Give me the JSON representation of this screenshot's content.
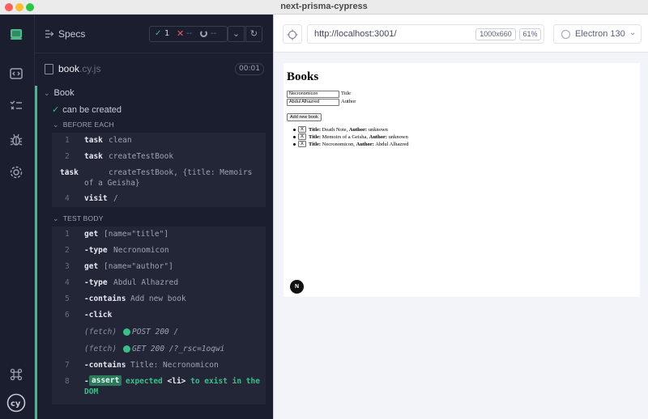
{
  "window": {
    "title": "next-prisma-cypress"
  },
  "reporter": {
    "specs_label": "Specs",
    "stats": {
      "passed": "1",
      "failed": "--",
      "pending": "--"
    },
    "file": {
      "name": "book",
      "ext": ".cy.js",
      "duration": "00:01"
    },
    "suite": {
      "title": "Book"
    },
    "test": {
      "title": "can be created"
    },
    "before_each": {
      "title": "BEFORE EACH",
      "commands": [
        {
          "num": "1",
          "name": "task",
          "message": "clean"
        },
        {
          "num": "2",
          "name": "task",
          "message": "createTestBook"
        },
        {
          "num": "3",
          "name": "task",
          "message": "createTestBook, {title: Memoirs of a Geisha}"
        },
        {
          "num": "4",
          "name": "visit",
          "message": "/"
        }
      ]
    },
    "test_body": {
      "title": "TEST BODY",
      "commands": [
        {
          "num": "1",
          "name": "get",
          "message": "[name=\"title\"]"
        },
        {
          "num": "2",
          "name": "-type",
          "message": "Necronomicon"
        },
        {
          "num": "3",
          "name": "get",
          "message": "[name=\"author\"]"
        },
        {
          "num": "4",
          "name": "-type",
          "message": "Abdul Alhazred"
        },
        {
          "num": "5",
          "name": "-contains",
          "message": "Add new book"
        },
        {
          "num": "6",
          "name": "-click",
          "message": ""
        },
        {
          "num": "",
          "name": "(fetch)",
          "message": "POST 200 /"
        },
        {
          "num": "",
          "name": "(fetch)",
          "message": "GET 200 /?_rsc=1oqwi"
        },
        {
          "num": "7",
          "name": "-contains",
          "message": "Title: Necronomicon"
        },
        {
          "num": "8",
          "name": "-",
          "badge": "assert",
          "expected": "expected",
          "subject": "<li>",
          "rest": "to exist in the DOM"
        }
      ]
    }
  },
  "browser": {
    "url": "http://localhost:3001/",
    "viewport": "1000x660",
    "zoom": "61%",
    "browser_name": "Electron 130"
  },
  "aut": {
    "heading": "Books",
    "title_input": {
      "value": "Necronomicon",
      "label": "Title"
    },
    "author_input": {
      "value": "Abdul Alhazred",
      "label": "Author"
    },
    "add_button": "Add new book",
    "books": [
      {
        "x": "X",
        "title_label": "Title:",
        "title": " Death Note, ",
        "author_label": "Author:",
        "author": " unknown"
      },
      {
        "x": "X",
        "title_label": "Title:",
        "title": " Memoirs of a Geisha, ",
        "author_label": "Author:",
        "author": " unknown"
      },
      {
        "x": "X",
        "title_label": "Title:",
        "title": " Necronomicon, ",
        "author_label": "Author:",
        "author": " Abdul Alhazred"
      }
    ],
    "next_badge": "N"
  },
  "colors": {
    "pass": "#38c087",
    "fail": "#ec5a71",
    "rail_bg": "#1b1e2e"
  },
  "icons": [
    "app-icon",
    "specs-icon",
    "runs-icon",
    "debug-icon",
    "settings-icon",
    "keyboard-shortcuts-icon",
    "cypress-logo-icon",
    "target-icon",
    "browser-icon",
    "reload-icon",
    "chevron-down-icon",
    "file-icon"
  ]
}
